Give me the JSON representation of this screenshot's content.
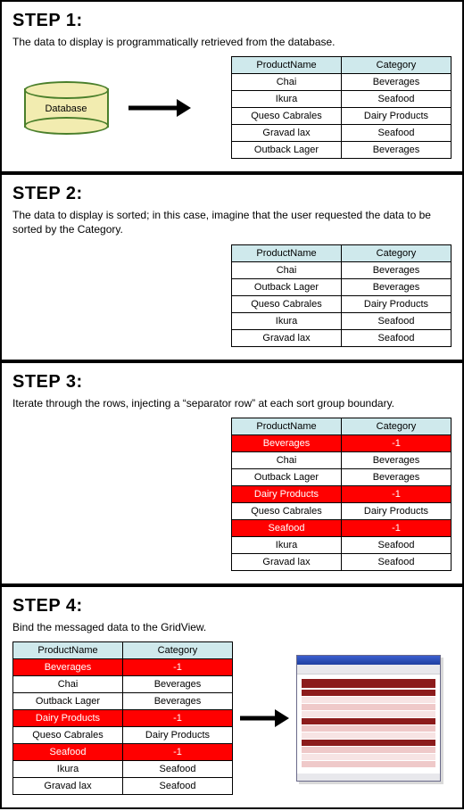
{
  "colors": {
    "tableHeaderBg": "#cfe9ec",
    "separatorBg": "#ff0000",
    "separatorFg": "#ffffff"
  },
  "step1": {
    "title": "STEP 1:",
    "desc": "The data to display is programmatically retrieved from the database.",
    "dbLabel": "Database",
    "columns": [
      "ProductName",
      "Category"
    ],
    "rows": [
      {
        "product": "Chai",
        "category": "Beverages"
      },
      {
        "product": "Ikura",
        "category": "Seafood"
      },
      {
        "product": "Queso Cabrales",
        "category": "Dairy Products"
      },
      {
        "product": "Gravad lax",
        "category": "Seafood"
      },
      {
        "product": "Outback Lager",
        "category": "Beverages"
      }
    ]
  },
  "step2": {
    "title": "STEP 2:",
    "desc": "The data to display is sorted; in this case, imagine that the user requested the data to be sorted by the Category.",
    "columns": [
      "ProductName",
      "Category"
    ],
    "rows": [
      {
        "product": "Chai",
        "category": "Beverages"
      },
      {
        "product": "Outback Lager",
        "category": "Beverages"
      },
      {
        "product": "Queso Cabrales",
        "category": "Dairy Products"
      },
      {
        "product": "Ikura",
        "category": "Seafood"
      },
      {
        "product": "Gravad lax",
        "category": "Seafood"
      }
    ]
  },
  "step3": {
    "title": "STEP 3:",
    "desc": "Iterate through the rows, injecting a “separator row” at each sort group boundary.",
    "columns": [
      "ProductName",
      "Category"
    ],
    "rows": [
      {
        "type": "separator",
        "product": "Beverages",
        "category": "-1"
      },
      {
        "type": "data",
        "product": "Chai",
        "category": "Beverages"
      },
      {
        "type": "data",
        "product": "Outback Lager",
        "category": "Beverages"
      },
      {
        "type": "separator",
        "product": "Dairy Products",
        "category": "-1"
      },
      {
        "type": "data",
        "product": "Queso Cabrales",
        "category": "Dairy Products"
      },
      {
        "type": "separator",
        "product": "Seafood",
        "category": "-1"
      },
      {
        "type": "data",
        "product": "Ikura",
        "category": "Seafood"
      },
      {
        "type": "data",
        "product": "Gravad lax",
        "category": "Seafood"
      }
    ]
  },
  "step4": {
    "title": "STEP 4:",
    "desc": "Bind the messaged data to the GridView.",
    "columns": [
      "ProductName",
      "Category"
    ],
    "rows": [
      {
        "type": "separator",
        "product": "Beverages",
        "category": "-1"
      },
      {
        "type": "data",
        "product": "Chai",
        "category": "Beverages"
      },
      {
        "type": "data",
        "product": "Outback Lager",
        "category": "Beverages"
      },
      {
        "type": "separator",
        "product": "Dairy Products",
        "category": "-1"
      },
      {
        "type": "data",
        "product": "Queso Cabrales",
        "category": "Dairy Products"
      },
      {
        "type": "separator",
        "product": "Seafood",
        "category": "-1"
      },
      {
        "type": "data",
        "product": "Ikura",
        "category": "Seafood"
      },
      {
        "type": "data",
        "product": "Gravad lax",
        "category": "Seafood"
      }
    ],
    "screenshotAlt": "Browser window showing GridView output"
  }
}
